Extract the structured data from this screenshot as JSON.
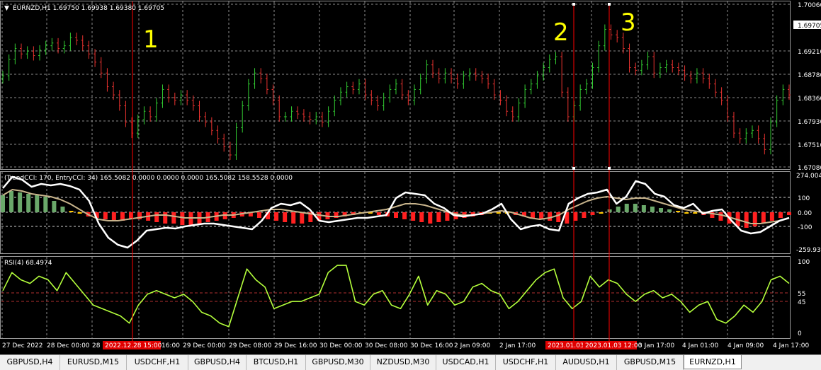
{
  "colors": {
    "background": "#000000",
    "bull_candle": "#32cd32",
    "bear_candle": "#e8322f",
    "grid": "#8c8c8c",
    "annotation_line": "#ff0000",
    "annotation_text": "#ffff00",
    "cci_white": "#ffffff",
    "cci_tan": "#c8b48c",
    "hist_green": "#6aa86a",
    "hist_red": "#ff2020",
    "hist_yellow": "#ffc800",
    "rsi_line": "#b4ff3c",
    "rsi_level": "#b03030"
  },
  "main": {
    "header": "EURNZD,H1  1.69750 1.69938 1.69380 1.69705",
    "price_labels": [
      "1.70060",
      "1.69210",
      "1.68780",
      "1.68360",
      "1.67930",
      "1.67510",
      "1.67080"
    ],
    "current_price": "1.69705",
    "annotations": [
      "1",
      "2",
      "3"
    ]
  },
  "cci_window": {
    "header": "(TrendCCI: 170, EntryCCI: 34)  165.5082 0.0000 0.0000 0.0000 165.5082 158.5528 0.0000",
    "levels": [
      "100",
      "0.00",
      "-100"
    ],
    "top_label": "274.0049",
    "bottom_label": "-259.938"
  },
  "rsi_window": {
    "header": "RSI(4) 68.4974",
    "levels": [
      "100",
      "55",
      "45",
      "0"
    ]
  },
  "time_axis": {
    "labels": [
      "27 Dec 2022",
      "28 Dec 00:00",
      "28 D",
      "16:00",
      "29 Dec 00:00",
      "29 Dec 08:00",
      "29 Dec 16:00",
      "30 Dec 00:00",
      "30 Dec 08:00",
      "30 Dec 16:00",
      "2 Jan 09:00",
      "2 Jan 17:00",
      "3 Jan 17:00",
      "4 Jan 01:00",
      "4 Jan 09:00",
      "4 Jan 17:00"
    ],
    "highlighted": [
      "2022.12.28 15:00",
      "2023.01.03 00",
      "2023.01.03 12:00"
    ]
  },
  "tabs": [
    "GBPUSD,H4",
    "EURUSD,M15",
    "USDCHF,H1",
    "GBPUSD,H4",
    "BTCUSD,H1",
    "GBPUSD,M30",
    "NZDUSD,M30",
    "USDCAD,H1",
    "USDCHF,H1",
    "AUDUSD,H1",
    "GBPUSD,M15",
    "EURNZD,H1"
  ],
  "active_tab": "EURNZD,H1",
  "series": {
    "price_closes": [
      1.6875,
      1.6905,
      1.6925,
      1.6915,
      1.692,
      1.6912,
      1.6922,
      1.693,
      1.6935,
      1.6925,
      1.693,
      1.6945,
      1.694,
      1.693,
      1.6915,
      1.69,
      1.688,
      1.6855,
      1.684,
      1.682,
      1.679,
      1.677,
      1.6795,
      1.681,
      1.68,
      1.6825,
      1.685,
      1.6835,
      1.683,
      1.684,
      1.683,
      1.682,
      1.68,
      1.679,
      1.6775,
      1.676,
      1.6745,
      1.673,
      1.678,
      1.682,
      1.686,
      1.688,
      1.687,
      1.685,
      1.683,
      1.68,
      1.68,
      1.681,
      1.6805,
      1.68,
      1.6795,
      1.68,
      1.679,
      1.681,
      1.683,
      1.6845,
      1.6855,
      1.685,
      1.686,
      1.684,
      1.683,
      1.682,
      1.6835,
      1.685,
      1.686,
      1.684,
      1.683,
      1.685,
      1.687,
      1.6895,
      1.688,
      1.687,
      1.688,
      1.687,
      1.686,
      1.6875,
      1.688,
      1.6875,
      1.687,
      1.686,
      1.684,
      1.683,
      1.681,
      1.68,
      1.6825,
      1.685,
      1.686,
      1.6875,
      1.689,
      1.6905,
      1.691,
      1.6845,
      1.68,
      1.682,
      1.685,
      1.686,
      1.689,
      1.693,
      1.696,
      1.695,
      1.6945,
      1.6925,
      1.689,
      1.6885,
      1.6895,
      1.691,
      1.688,
      1.689,
      1.6895,
      1.689,
      1.6885,
      1.6875,
      1.687,
      1.688,
      1.687,
      1.686,
      1.6845,
      1.683,
      1.68,
      1.677,
      1.676,
      1.677,
      1.6775,
      1.676,
      1.674,
      1.679,
      1.683,
      1.685,
      1.684
    ],
    "cci_white": [
      170,
      250,
      230,
      180,
      200,
      190,
      200,
      185,
      160,
      80,
      -80,
      -180,
      -230,
      -250,
      -200,
      -130,
      -120,
      -110,
      -115,
      -100,
      -90,
      -80,
      -80,
      -90,
      -100,
      -110,
      -120,
      -60,
      30,
      60,
      50,
      70,
      20,
      -60,
      -70,
      -60,
      -50,
      -40,
      -40,
      -30,
      -20,
      100,
      140,
      130,
      120,
      60,
      30,
      -20,
      -30,
      -20,
      -10,
      20,
      60,
      -50,
      -120,
      -100,
      -90,
      -120,
      -130,
      60,
      100,
      130,
      140,
      160,
      60,
      110,
      220,
      200,
      130,
      110,
      50,
      30,
      60,
      -10,
      10,
      20,
      -60,
      -130,
      -150,
      -140,
      -100,
      -60,
      -40
    ],
    "cci_tan": [
      120,
      160,
      150,
      130,
      120,
      110,
      90,
      60,
      20,
      -20,
      -50,
      -60,
      -60,
      -50,
      -40,
      -30,
      -20,
      -20,
      -30,
      -40,
      -40,
      -40,
      -30,
      -20,
      -20,
      -10,
      0,
      10,
      20,
      20,
      10,
      0,
      -10,
      -20,
      -30,
      -30,
      -20,
      -10,
      0,
      10,
      20,
      40,
      60,
      60,
      50,
      30,
      10,
      -10,
      -20,
      -20,
      -10,
      0,
      10,
      0,
      -20,
      -40,
      -50,
      -40,
      -20,
      20,
      50,
      80,
      100,
      110,
      100,
      90,
      100,
      100,
      80,
      60,
      40,
      20,
      10,
      0,
      -10,
      -20,
      -40,
      -60,
      -80,
      -80,
      -70,
      -60,
      -40
    ],
    "cci_hist": [
      120,
      150,
      140,
      130,
      120,
      110,
      80,
      40,
      10,
      -10,
      -30,
      -40,
      -50,
      -60,
      -60,
      -50,
      -50,
      -60,
      -70,
      -80,
      -80,
      -90,
      -90,
      -80,
      -70,
      -60,
      -50,
      -40,
      -30,
      -30,
      -40,
      -50,
      -60,
      -70,
      -80,
      -80,
      -70,
      -60,
      -50,
      -40,
      -30,
      -20,
      0,
      -10,
      -20,
      -30,
      -40,
      -50,
      -60,
      -70,
      -80,
      -70,
      -60,
      -50,
      -40,
      -30,
      -20,
      -10,
      0,
      -10,
      -20,
      -30,
      -40,
      -50,
      -60,
      -70,
      -80,
      -60,
      -40,
      -20,
      0,
      20,
      40,
      60,
      60,
      50,
      40,
      30,
      20,
      10,
      0,
      -10,
      -20,
      -40,
      -60,
      -80,
      -100,
      -110,
      -100,
      -80,
      -60,
      -40,
      -20
    ],
    "rsi": [
      60,
      85,
      75,
      70,
      80,
      75,
      60,
      85,
      70,
      55,
      40,
      35,
      30,
      25,
      15,
      40,
      55,
      60,
      55,
      50,
      55,
      45,
      30,
      25,
      15,
      10,
      50,
      90,
      75,
      65,
      35,
      40,
      45,
      45,
      50,
      55,
      85,
      95,
      95,
      45,
      40,
      55,
      60,
      40,
      35,
      55,
      80,
      40,
      60,
      55,
      40,
      45,
      65,
      70,
      60,
      55,
      35,
      45,
      60,
      75,
      85,
      90,
      50,
      35,
      45,
      80,
      65,
      75,
      70,
      55,
      45,
      55,
      60,
      50,
      55,
      45,
      30,
      40,
      45,
      20,
      15,
      25,
      40,
      30,
      45,
      75,
      80,
      70
    ]
  }
}
